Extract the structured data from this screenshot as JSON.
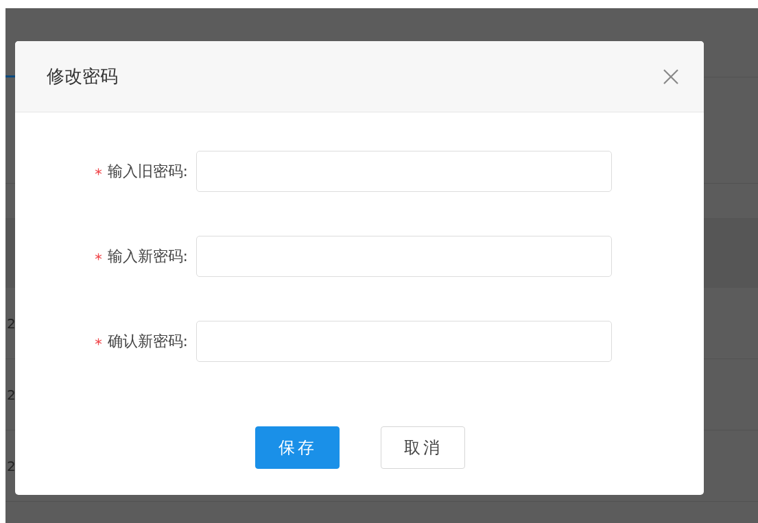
{
  "background": {
    "rows": [
      {
        "column_1": "2"
      },
      {
        "column_1": "2"
      },
      {
        "column_1": "2"
      }
    ]
  },
  "dialog": {
    "title": "修改密码",
    "fields": [
      {
        "label": "输入旧密码:",
        "required": true
      },
      {
        "label": "输入新密码:",
        "required": true
      },
      {
        "label": "确认新密码:",
        "required": true
      }
    ],
    "buttons": [
      {
        "label": "保存",
        "kind": "primary"
      },
      {
        "label": "取消",
        "kind": "default"
      }
    ]
  }
}
